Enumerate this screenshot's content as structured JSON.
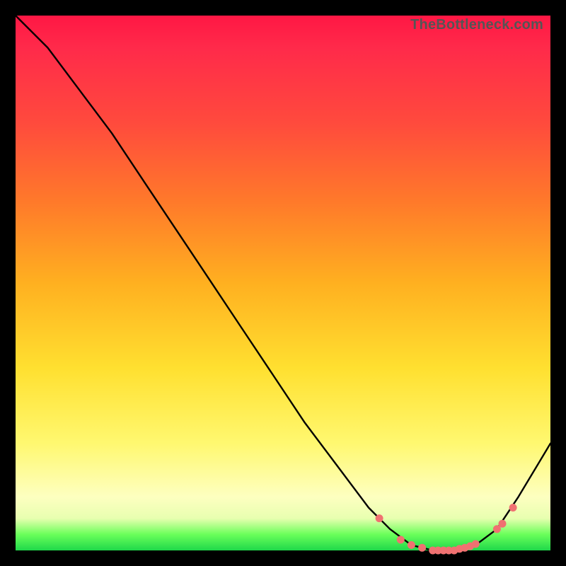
{
  "watermark": "TheBottleneck.com",
  "chart_data": {
    "type": "line",
    "title": "",
    "xlabel": "",
    "ylabel": "",
    "xlim": [
      0,
      100
    ],
    "ylim": [
      0,
      100
    ],
    "grid": false,
    "legend": false,
    "series": [
      {
        "name": "bottleneck-curve",
        "x": [
          0,
          6,
          12,
          18,
          24,
          30,
          36,
          42,
          48,
          54,
          60,
          66,
          70,
          74,
          78,
          82,
          86,
          90,
          94,
          100
        ],
        "y": [
          100,
          94,
          86,
          78,
          69,
          60,
          51,
          42,
          33,
          24,
          16,
          8,
          4,
          1,
          0,
          0,
          1,
          4,
          10,
          20
        ]
      }
    ],
    "markers": {
      "name": "highlighted-points",
      "color": "#f07171",
      "x": [
        68,
        72,
        74,
        76,
        78,
        79,
        80,
        81,
        82,
        83,
        84,
        85,
        86,
        90,
        91,
        93
      ],
      "y": [
        6,
        2,
        1,
        0.5,
        0,
        0,
        0,
        0,
        0,
        0.3,
        0.5,
        0.8,
        1.2,
        4,
        5,
        8
      ]
    }
  }
}
